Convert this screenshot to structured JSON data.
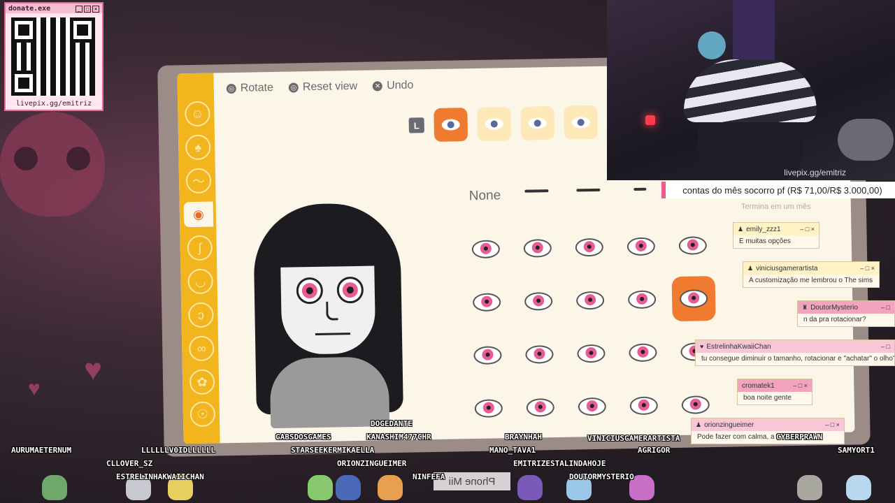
{
  "donate": {
    "title": "donate.exe",
    "url": "livepix.gg/emitriz"
  },
  "game": {
    "hints": [
      {
        "icon": "rotate-icon",
        "label": "Rotate"
      },
      {
        "icon": "reset-view-icon",
        "label": "Reset view"
      },
      {
        "icon": "undo-icon",
        "label": "Undo"
      }
    ],
    "tab_l": "L",
    "none_label": "None"
  },
  "webcam": {
    "watermark": "livepix.gg/emitriz"
  },
  "goal": {
    "text": "contas do mês socorro pf (R$ 71,00/R$ 3.000,00)",
    "sub": "Termina em um mês"
  },
  "chat": [
    {
      "user": "emily_zzz1",
      "message": "E muitas opções"
    },
    {
      "user": "viniciusgamerartista",
      "message": "A customização me lembrou o The sims"
    },
    {
      "user": "DoutorMysterio",
      "message": "n da pra rotacionar?"
    },
    {
      "user": "EstrelinhaKwaiiChan",
      "message": "tu consegue diminuir o tamanho, rotacionar e \"achatar\" o olho?"
    },
    {
      "user": "cromatek1",
      "message": "boa noite gente"
    },
    {
      "user": "orionzingueimer",
      "message": "Pode fazer com calma, a"
    }
  ],
  "viewers": [
    "DOGEDANTE",
    "GABSDOSGAMES",
    "KANASHIM477CHR",
    "BRAYNHAH",
    "AURUMAETERNUM",
    "LLLLLLV0IDLLLLLL",
    "STARSEEKERMIKAELLA",
    "MANO_TAVA1",
    "VINICIUSGAMERARTISTA",
    "AGRIGOR",
    "CYBERPRAWN",
    "SAMYORT1",
    "CLLOVER_SZ",
    "ORIONZINGUEIMER",
    "EMITRIZESTALINDAHOJE",
    "ESTRELINHAKWAIICHAN",
    "NINFEFA",
    "DOUTORMYSTERIO"
  ],
  "phone_label": "Phone Mii",
  "colors": {
    "accent": "#f07a30",
    "sidebar": "#f2b51e",
    "eye": "#e85c95",
    "overlay_pink": "#f05a8a"
  }
}
